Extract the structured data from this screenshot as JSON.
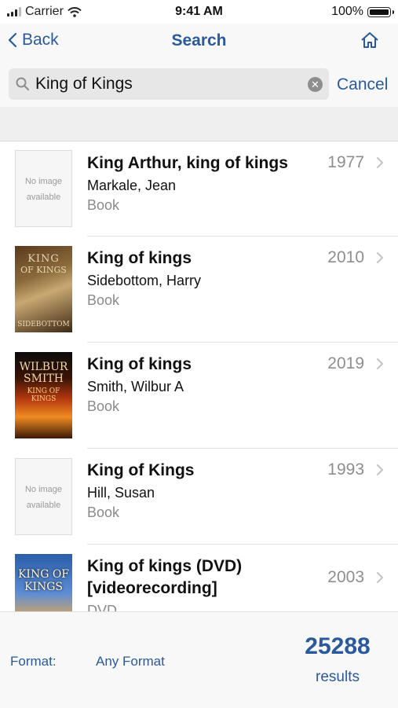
{
  "status_bar": {
    "carrier": "Carrier",
    "time": "9:41 AM",
    "battery": "100%"
  },
  "nav": {
    "back_label": "Back",
    "title": "Search",
    "home_icon": "home-icon"
  },
  "search": {
    "query": "King of Kings",
    "cancel_label": "Cancel"
  },
  "results": [
    {
      "title": "King Arthur, king of kings",
      "author": "Markale, Jean",
      "format": "Book",
      "year": "1977",
      "no_image_text_1": "No image",
      "no_image_text_2": "available"
    },
    {
      "title": "King of kings",
      "author": "Sidebottom, Harry",
      "format": "Book",
      "year": "2010",
      "cover_line1": "KING",
      "cover_line2": "OF KINGS",
      "cover_author": "SIDEBOTTOM"
    },
    {
      "title": "King of kings",
      "author": "Smith, Wilbur A",
      "format": "Book",
      "year": "2019",
      "cover_line1": "WILBUR",
      "cover_line2": "SMITH",
      "cover_title": "KING OF KINGS"
    },
    {
      "title": "King of Kings",
      "author": "Hill, Susan",
      "format": "Book",
      "year": "1993",
      "no_image_text_1": "No image",
      "no_image_text_2": "available"
    },
    {
      "title": "King of kings (DVD) [videorecording]",
      "author": "",
      "format": "DVD",
      "year": "2003",
      "cover_line1": "KING OF KINGS"
    }
  ],
  "footer": {
    "format_label": "Format:",
    "format_value": "Any Format",
    "count": "25288",
    "count_label": "results"
  },
  "colors": {
    "accent": "#2a5a9c",
    "secondary_text": "#8e8e8e"
  }
}
